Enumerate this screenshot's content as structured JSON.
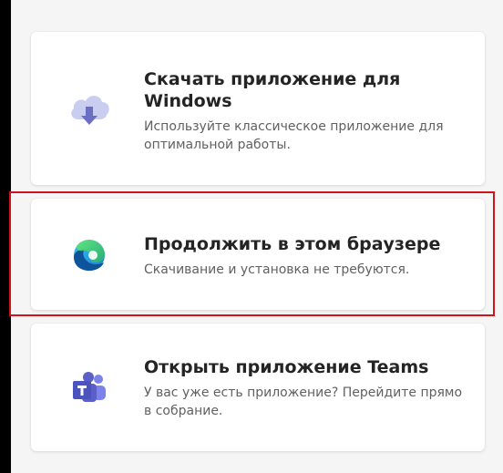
{
  "options": [
    {
      "title": "Скачать приложение для Windows",
      "description": "Используйте классическое приложение для оптимальной работы.",
      "icon": "cloud-download-icon"
    },
    {
      "title": "Продолжить в этом браузере",
      "description": "Скачивание и установка не требуются.",
      "icon": "edge-browser-icon"
    },
    {
      "title": "Открыть приложение Teams",
      "description": "У вас уже есть приложение? Перейдите прямо в собрание.",
      "icon": "teams-icon"
    }
  ],
  "colors": {
    "highlight": "#d0121b",
    "card_background": "#ffffff",
    "page_background": "#f5f5f5",
    "teams_purple": "#5b5fc7",
    "cloud_lavender": "#c9cdf0"
  }
}
